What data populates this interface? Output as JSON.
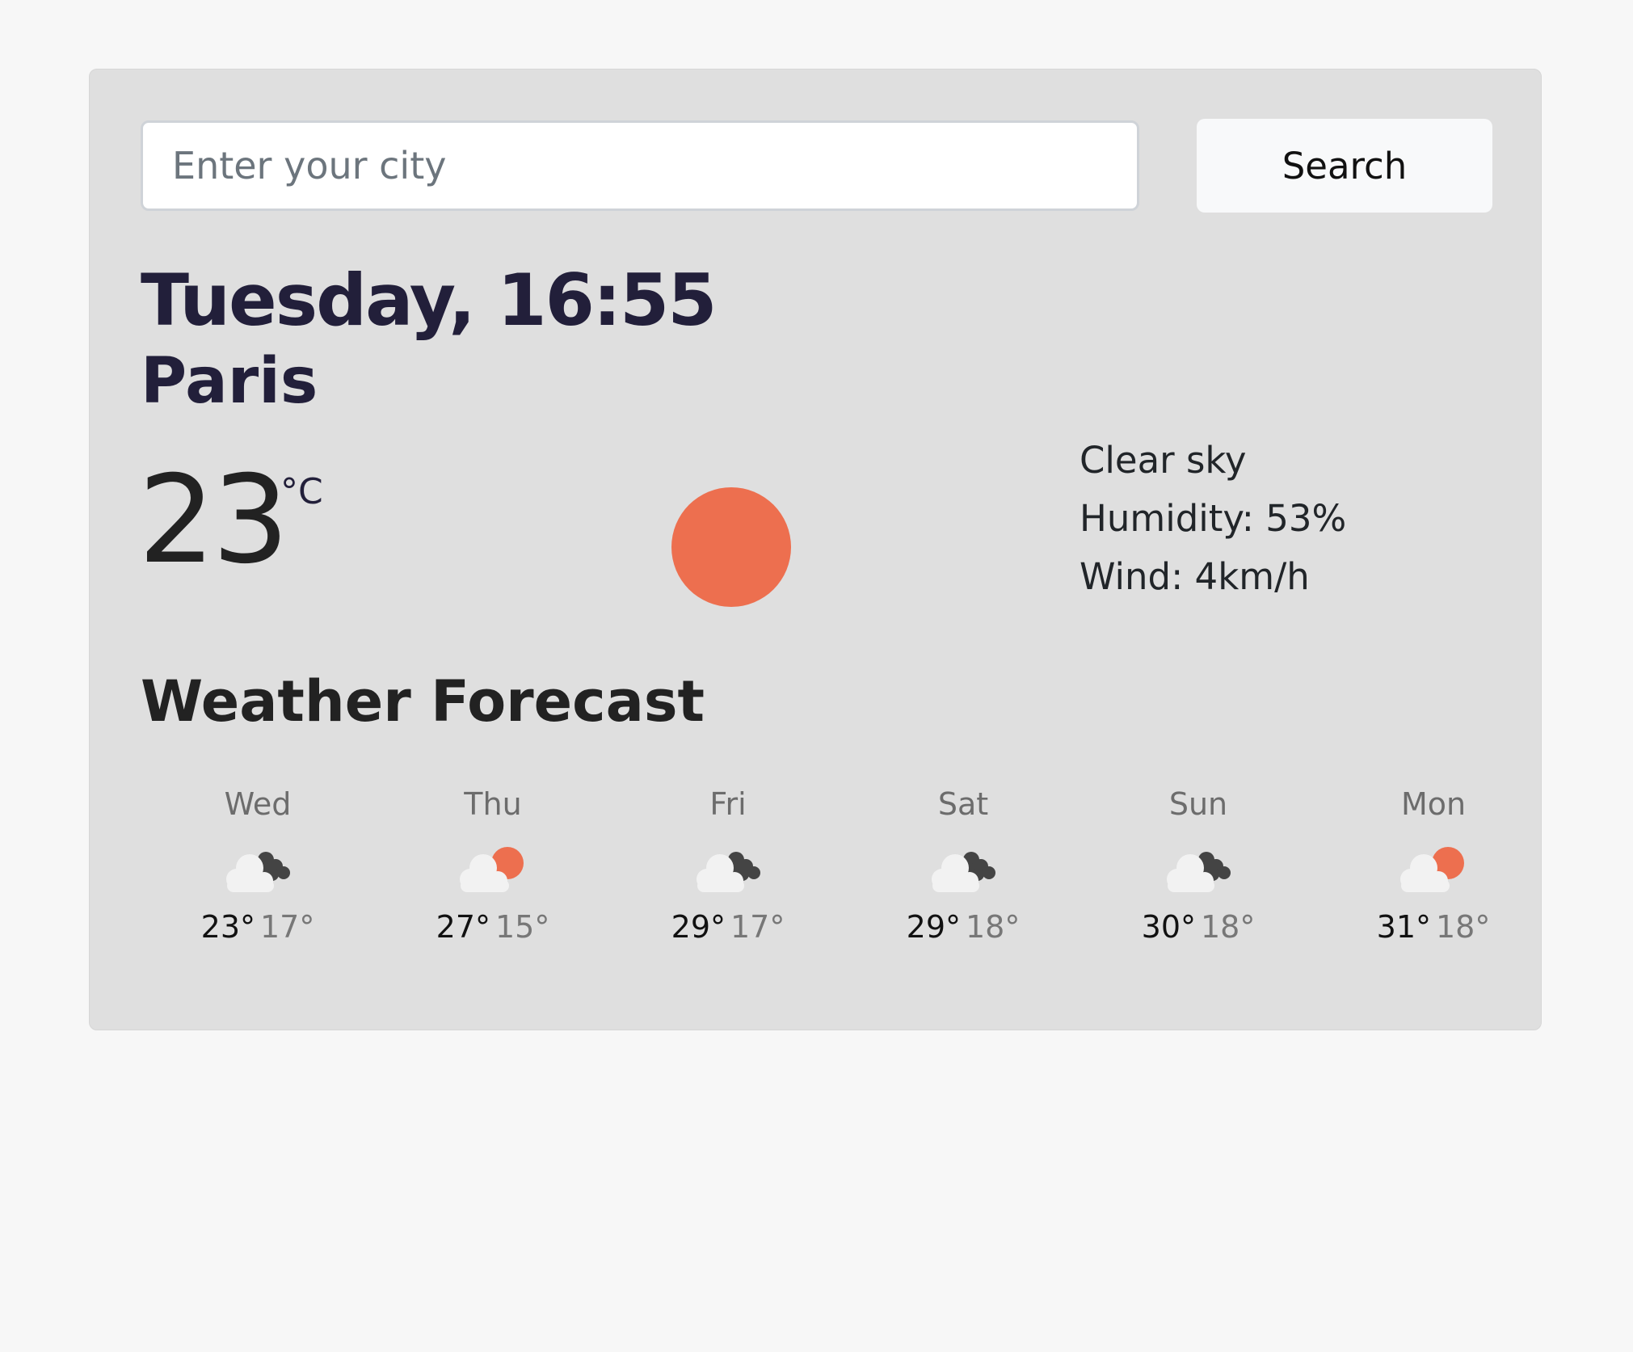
{
  "search": {
    "placeholder": "Enter your city",
    "value": "",
    "button_label": "Search"
  },
  "current": {
    "date_time": "Tuesday, 16:55",
    "city": "Paris",
    "temperature": "23",
    "unit": "°C",
    "icon": "sun-icon",
    "description": "Clear sky",
    "humidity": "Humidity: 53%",
    "wind": "Wind: 4km/h"
  },
  "forecast": {
    "heading": "Weather Forecast",
    "days": [
      {
        "day": "Wed",
        "icon": "cloud-dark-icon",
        "max": "23°",
        "min": "17°"
      },
      {
        "day": "Thu",
        "icon": "cloud-sun-icon",
        "max": "27°",
        "min": "15°"
      },
      {
        "day": "Fri",
        "icon": "cloud-dark-icon",
        "max": "29°",
        "min": "17°"
      },
      {
        "day": "Sat",
        "icon": "cloud-dark-icon",
        "max": "29°",
        "min": "18°"
      },
      {
        "day": "Sun",
        "icon": "cloud-dark-icon",
        "max": "30°",
        "min": "18°"
      },
      {
        "day": "Mon",
        "icon": "cloud-sun-icon",
        "max": "31°",
        "min": "18°"
      }
    ]
  },
  "colors": {
    "page_background": "#f7f7f7",
    "card_background": "#dfdfdf",
    "sun": "#ed6f4f",
    "heading_text": "#221f3a",
    "dark_cloud": "#444444",
    "light_cloud": "#f2f2f2"
  }
}
